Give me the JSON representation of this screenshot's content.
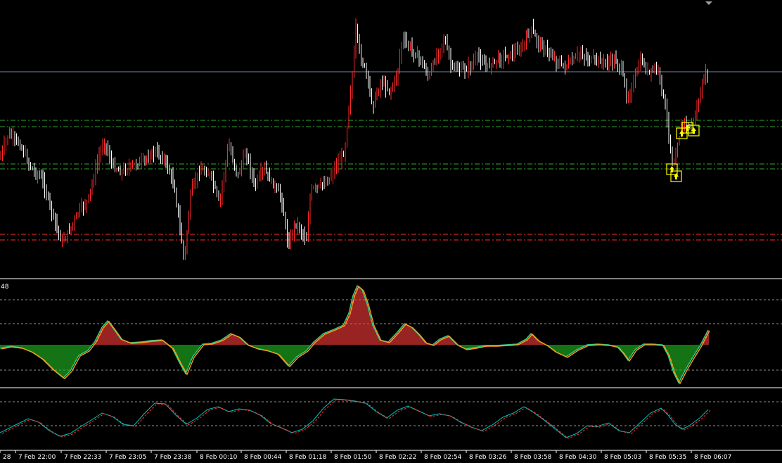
{
  "chart_data": {
    "type": "bar",
    "symbol_panel": "price",
    "colors": {
      "background": "#000000",
      "bull_bar": "#ff2a2a",
      "bear_bar": "#ffffff",
      "green_level": "#2ea82e",
      "red_level": "#ff2a2a",
      "current_price_line": "#6f86a6",
      "hist_up": "#ff3b3b",
      "hist_down": "#21c021",
      "osc_line_a": "#ff9a1a",
      "osc_line_b": "#2dcf88",
      "sig_a": "#ff3333",
      "sig_b": "#00c0c0",
      "marker": "#ffff00",
      "separator": "#ffffff",
      "grid": "#c0c0c0"
    },
    "x_ticks": [
      "28",
      "7 Feb 22:00",
      "7 Feb 22:33",
      "7 Feb 23:05",
      "7 Feb 23:38",
      "8 Feb 00:10",
      "8 Feb 00:44",
      "8 Feb 01:18",
      "8 Feb 01:50",
      "8 Feb 02:22",
      "8 Feb 02:54",
      "8 Feb 03:26",
      "8 Feb 03:58",
      "8 Feb 04:30",
      "8 Feb 05:03",
      "8 Feb 05:35",
      "8 Feb 06:07"
    ],
    "indicator1_label": "48",
    "price_path": [
      [
        0,
        225
      ],
      [
        12,
        190
      ],
      [
        28,
        205
      ],
      [
        45,
        240
      ],
      [
        60,
        255
      ],
      [
        75,
        305
      ],
      [
        88,
        345
      ],
      [
        100,
        325
      ],
      [
        112,
        300
      ],
      [
        125,
        285
      ],
      [
        140,
        225
      ],
      [
        148,
        200
      ],
      [
        160,
        235
      ],
      [
        172,
        245
      ],
      [
        188,
        235
      ],
      [
        205,
        228
      ],
      [
        220,
        215
      ],
      [
        235,
        228
      ],
      [
        248,
        265
      ],
      [
        262,
        370
      ],
      [
        272,
        270
      ],
      [
        285,
        240
      ],
      [
        300,
        250
      ],
      [
        312,
        290
      ],
      [
        325,
        205
      ],
      [
        338,
        250
      ],
      [
        350,
        215
      ],
      [
        362,
        265
      ],
      [
        375,
        240
      ],
      [
        390,
        265
      ],
      [
        400,
        280
      ],
      [
        410,
        350
      ],
      [
        420,
        315
      ],
      [
        436,
        340
      ],
      [
        442,
        270
      ],
      [
        455,
        265
      ],
      [
        468,
        255
      ],
      [
        478,
        235
      ],
      [
        490,
        215
      ],
      [
        496,
        150
      ],
      [
        502,
        100
      ],
      [
        506,
        40
      ],
      [
        512,
        80
      ],
      [
        520,
        100
      ],
      [
        530,
        150
      ],
      [
        542,
        115
      ],
      [
        555,
        130
      ],
      [
        565,
        105
      ],
      [
        572,
        55
      ],
      [
        585,
        70
      ],
      [
        598,
        85
      ],
      [
        610,
        110
      ],
      [
        622,
        75
      ],
      [
        632,
        55
      ],
      [
        642,
        95
      ],
      [
        655,
        100
      ],
      [
        668,
        95
      ],
      [
        680,
        80
      ],
      [
        692,
        95
      ],
      [
        705,
        85
      ],
      [
        718,
        80
      ],
      [
        730,
        75
      ],
      [
        742,
        70
      ],
      [
        755,
        40
      ],
      [
        762,
        55
      ],
      [
        775,
        70
      ],
      [
        790,
        85
      ],
      [
        800,
        95
      ],
      [
        812,
        90
      ],
      [
        825,
        75
      ],
      [
        838,
        85
      ],
      [
        850,
        85
      ],
      [
        862,
        90
      ],
      [
        875,
        85
      ],
      [
        884,
        100
      ],
      [
        892,
        140
      ],
      [
        900,
        120
      ],
      [
        912,
        85
      ],
      [
        922,
        105
      ],
      [
        935,
        95
      ],
      [
        942,
        130
      ],
      [
        950,
        180
      ],
      [
        957,
        240
      ],
      [
        964,
        200
      ],
      [
        972,
        170
      ],
      [
        980,
        185
      ],
      [
        990,
        160
      ],
      [
        1000,
        115
      ],
      [
        1007,
        100
      ]
    ],
    "hist_path": [
      [
        0,
        495
      ],
      [
        15,
        492
      ],
      [
        30,
        494
      ],
      [
        45,
        500
      ],
      [
        60,
        510
      ],
      [
        75,
        525
      ],
      [
        90,
        537
      ],
      [
        100,
        527
      ],
      [
        112,
        505
      ],
      [
        125,
        498
      ],
      [
        135,
        485
      ],
      [
        145,
        465
      ],
      [
        153,
        456
      ],
      [
        162,
        468
      ],
      [
        172,
        482
      ],
      [
        185,
        487
      ],
      [
        200,
        486
      ],
      [
        215,
        484
      ],
      [
        230,
        483
      ],
      [
        245,
        495
      ],
      [
        255,
        515
      ],
      [
        264,
        531
      ],
      [
        274,
        507
      ],
      [
        288,
        489
      ],
      [
        300,
        488
      ],
      [
        315,
        483
      ],
      [
        328,
        474
      ],
      [
        340,
        479
      ],
      [
        352,
        490
      ],
      [
        365,
        495
      ],
      [
        380,
        498
      ],
      [
        395,
        503
      ],
      [
        410,
        520
      ],
      [
        422,
        507
      ],
      [
        436,
        498
      ],
      [
        446,
        486
      ],
      [
        460,
        474
      ],
      [
        475,
        468
      ],
      [
        488,
        462
      ],
      [
        496,
        445
      ],
      [
        502,
        420
      ],
      [
        508,
        406
      ],
      [
        515,
        412
      ],
      [
        522,
        432
      ],
      [
        530,
        462
      ],
      [
        540,
        483
      ],
      [
        552,
        486
      ],
      [
        565,
        472
      ],
      [
        575,
        460
      ],
      [
        585,
        465
      ],
      [
        595,
        475
      ],
      [
        605,
        487
      ],
      [
        615,
        490
      ],
      [
        625,
        482
      ],
      [
        637,
        477
      ],
      [
        650,
        490
      ],
      [
        662,
        496
      ],
      [
        675,
        494
      ],
      [
        690,
        491
      ],
      [
        705,
        491
      ],
      [
        720,
        490
      ],
      [
        735,
        489
      ],
      [
        748,
        482
      ],
      [
        755,
        474
      ],
      [
        765,
        484
      ],
      [
        778,
        491
      ],
      [
        790,
        500
      ],
      [
        805,
        507
      ],
      [
        820,
        497
      ],
      [
        835,
        490
      ],
      [
        850,
        489
      ],
      [
        865,
        490
      ],
      [
        878,
        493
      ],
      [
        886,
        502
      ],
      [
        893,
        512
      ],
      [
        903,
        497
      ],
      [
        915,
        489
      ],
      [
        928,
        489
      ],
      [
        942,
        490
      ],
      [
        950,
        505
      ],
      [
        958,
        530
      ],
      [
        965,
        544
      ],
      [
        975,
        525
      ],
      [
        985,
        508
      ],
      [
        995,
        492
      ],
      [
        1007,
        469
      ]
    ],
    "hist_zero_y": 490,
    "osc_path": [
      [
        0,
        615
      ],
      [
        20,
        605
      ],
      [
        40,
        595
      ],
      [
        55,
        600
      ],
      [
        70,
        612
      ],
      [
        85,
        620
      ],
      [
        100,
        616
      ],
      [
        115,
        606
      ],
      [
        130,
        597
      ],
      [
        145,
        587
      ],
      [
        160,
        592
      ],
      [
        175,
        603
      ],
      [
        190,
        605
      ],
      [
        205,
        588
      ],
      [
        220,
        573
      ],
      [
        235,
        574
      ],
      [
        250,
        590
      ],
      [
        265,
        603
      ],
      [
        280,
        594
      ],
      [
        295,
        582
      ],
      [
        310,
        578
      ],
      [
        325,
        585
      ],
      [
        340,
        581
      ],
      [
        355,
        583
      ],
      [
        370,
        590
      ],
      [
        385,
        602
      ],
      [
        400,
        608
      ],
      [
        415,
        615
      ],
      [
        430,
        610
      ],
      [
        445,
        598
      ],
      [
        460,
        580
      ],
      [
        475,
        567
      ],
      [
        490,
        568
      ],
      [
        505,
        570
      ],
      [
        520,
        573
      ],
      [
        535,
        585
      ],
      [
        550,
        594
      ],
      [
        565,
        583
      ],
      [
        580,
        577
      ],
      [
        595,
        584
      ],
      [
        610,
        591
      ],
      [
        625,
        588
      ],
      [
        640,
        591
      ],
      [
        655,
        600
      ],
      [
        670,
        607
      ],
      [
        685,
        612
      ],
      [
        700,
        604
      ],
      [
        715,
        593
      ],
      [
        730,
        587
      ],
      [
        745,
        578
      ],
      [
        760,
        587
      ],
      [
        775,
        598
      ],
      [
        790,
        610
      ],
      [
        805,
        622
      ],
      [
        820,
        616
      ],
      [
        835,
        605
      ],
      [
        850,
        606
      ],
      [
        865,
        601
      ],
      [
        880,
        612
      ],
      [
        895,
        615
      ],
      [
        910,
        601
      ],
      [
        925,
        587
      ],
      [
        940,
        580
      ],
      [
        950,
        590
      ],
      [
        960,
        603
      ],
      [
        970,
        610
      ],
      [
        980,
        605
      ],
      [
        995,
        594
      ],
      [
        1007,
        582
      ]
    ],
    "green_levels_y": [
      171,
      180,
      233,
      240
    ],
    "red_levels_y": [
      333,
      341
    ],
    "current_price_y": 102,
    "hist_dashed_y": [
      426,
      460,
      526
    ],
    "osc_dashed_y": [
      571,
      605
    ]
  }
}
